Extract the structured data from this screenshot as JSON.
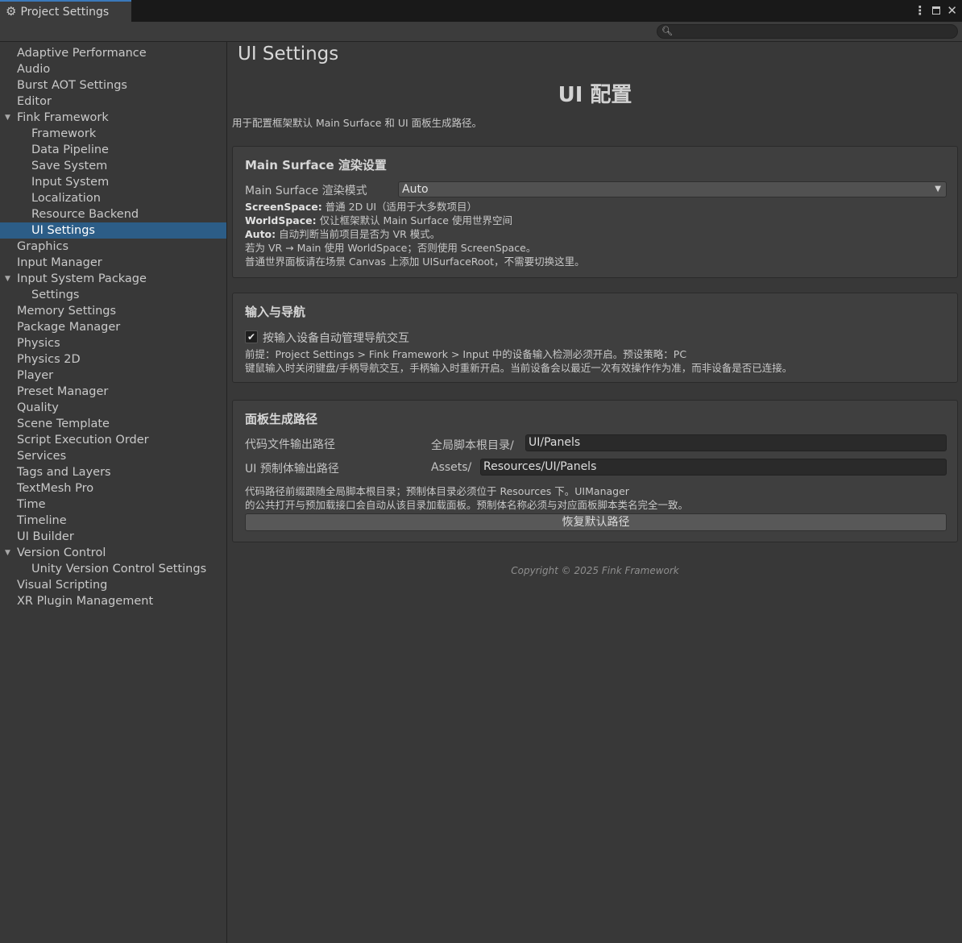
{
  "window": {
    "tab_title": "Project Settings",
    "tab_icon": "gear-icon",
    "accent_color": "#3a79bb",
    "selected_color": "#2c5d87"
  },
  "search": {
    "placeholder": "",
    "value": ""
  },
  "sidebar": {
    "items": [
      {
        "label": "Adaptive Performance",
        "level": 0
      },
      {
        "label": "Audio",
        "level": 0
      },
      {
        "label": "Burst AOT Settings",
        "level": 0
      },
      {
        "label": "Editor",
        "level": 0
      },
      {
        "label": "Fink Framework",
        "level": 0,
        "expanded": true
      },
      {
        "label": "Framework",
        "level": 1
      },
      {
        "label": "Data Pipeline",
        "level": 1
      },
      {
        "label": "Save System",
        "level": 1
      },
      {
        "label": "Input System",
        "level": 1
      },
      {
        "label": "Localization",
        "level": 1
      },
      {
        "label": "Resource Backend",
        "level": 1
      },
      {
        "label": "UI Settings",
        "level": 1,
        "selected": true
      },
      {
        "label": "Graphics",
        "level": 0
      },
      {
        "label": "Input Manager",
        "level": 0
      },
      {
        "label": "Input System Package",
        "level": 0,
        "expanded": true
      },
      {
        "label": "Settings",
        "level": 1
      },
      {
        "label": "Memory Settings",
        "level": 0
      },
      {
        "label": "Package Manager",
        "level": 0
      },
      {
        "label": "Physics",
        "level": 0
      },
      {
        "label": "Physics 2D",
        "level": 0
      },
      {
        "label": "Player",
        "level": 0
      },
      {
        "label": "Preset Manager",
        "level": 0
      },
      {
        "label": "Quality",
        "level": 0
      },
      {
        "label": "Scene Template",
        "level": 0
      },
      {
        "label": "Script Execution Order",
        "level": 0
      },
      {
        "label": "Services",
        "level": 0
      },
      {
        "label": "Tags and Layers",
        "level": 0
      },
      {
        "label": "TextMesh Pro",
        "level": 0
      },
      {
        "label": "Time",
        "level": 0
      },
      {
        "label": "Timeline",
        "level": 0
      },
      {
        "label": "UI Builder",
        "level": 0
      },
      {
        "label": "Version Control",
        "level": 0,
        "expanded": true
      },
      {
        "label": "Unity Version Control Settings",
        "level": 1
      },
      {
        "label": "Visual Scripting",
        "level": 0
      },
      {
        "label": "XR Plugin Management",
        "level": 0
      }
    ]
  },
  "main": {
    "page_title": "UI Settings",
    "hero_title": "UI 配置",
    "description": "用于配置框架默认 Main Surface 和 UI 面板生成路径。",
    "render_section": {
      "title": "Main Surface 渲染设置",
      "mode_label": "Main Surface 渲染模式",
      "mode_value": "Auto",
      "info": [
        {
          "key": "ScreenSpace:",
          "text": " 普通 2D UI（适用于大多数项目）"
        },
        {
          "key": "WorldSpace:",
          "text": " 仅让框架默认 Main Surface 使用世界空间"
        },
        {
          "key": "Auto:",
          "text": " 自动判断当前项目是否为 VR 模式。"
        },
        {
          "key": "",
          "text": "若为 VR → Main 使用 WorldSpace；否则使用 ScreenSpace。"
        },
        {
          "key": "",
          "text": "普通世界面板请在场景 Canvas 上添加 UISurfaceRoot，不需要切换这里。"
        }
      ]
    },
    "input_section": {
      "title": "输入与导航",
      "checkbox_label": "按输入设备自动管理导航交互",
      "checked": true,
      "info_1": "前提：Project Settings > Fink Framework > Input 中的设备输入检测必须开启。预设策略：PC",
      "info_2": "键鼠输入时关闭键盘/手柄导航交互，手柄输入时重新开启。当前设备会以最近一次有效操作作为准，而非设备是否已连接。"
    },
    "path_section": {
      "title": "面板生成路径",
      "code_label": "代码文件输出路径",
      "code_prefix": "全局脚本根目录/",
      "code_value": "UI/Panels",
      "prefab_label": "UI 预制体输出路径",
      "prefab_prefix": "Assets/",
      "prefab_value": "Resources/UI/Panels",
      "info_1": "代码路径前缀跟随全局脚本根目录；预制体目录必须位于 Resources 下。UIManager",
      "info_2": "的公共打开与预加载接口会自动从该目录加载面板。预制体名称必须与对应面板脚本类名完全一致。",
      "reset_button": "恢复默认路径"
    },
    "copyright": "Copyright © 2025 Fink Framework"
  }
}
